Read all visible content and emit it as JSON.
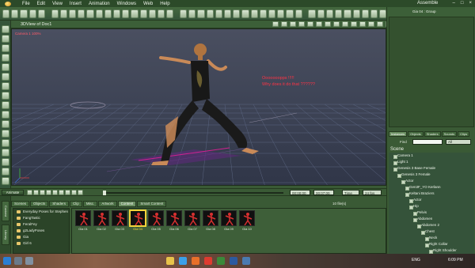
{
  "menubar": {
    "items": [
      "File",
      "Edit",
      "View",
      "Insert",
      "Animation",
      "Windows",
      "Web",
      "Help"
    ],
    "right_label": "Assemble"
  },
  "viewport": {
    "title": "3DView of Doc1",
    "camera_label": "Camera 1 100%",
    "annotation_lines": [
      "Ooooooopps !!!!!",
      "Why does it do that ??????"
    ],
    "annotation_color": "#ff3345"
  },
  "timeline": {
    "animate_label": "Animate",
    "start_time": "00:00:00",
    "end_time": "00:07:00",
    "mode": "Time",
    "fps": "24 fps"
  },
  "content": {
    "tabs": [
      "Scenes",
      "Objects",
      "Shaders",
      "Clip",
      "Misc.",
      "Artwork",
      "Content",
      "Smart Content"
    ],
    "active_tab": "Content",
    "files_count": "10 file(s)",
    "categories": [
      "Everyday Poses for Stephen",
      "FangTastic",
      "FeralFey",
      "g2LadyPoses",
      "Gia",
      "Girl 6"
    ],
    "thumbnails": [
      "Gia 01",
      "Gia 02",
      "Gia 03",
      "Gia 04",
      "Gia 05",
      "Gia 06",
      "Gia 07",
      "Gia 08",
      "Gia 09",
      "Gia 10"
    ],
    "selected_thumb": "Gia 04",
    "side_tabs": [
      "Content",
      "Library"
    ]
  },
  "right_panel": {
    "top_title": "Gia 04 : Group",
    "tabs": [
      "Instances",
      "Objects",
      "Shaders",
      "Sounds",
      "Clips"
    ],
    "active_tab": "Instances",
    "find_label": "Find",
    "find_value": "",
    "filter_value": "All",
    "scene_title": "Scene",
    "tree": [
      {
        "label": "Camera 1",
        "depth": 1
      },
      {
        "label": "Light 1",
        "depth": 1
      },
      {
        "label": "Genesis 3 Base Female",
        "depth": 1
      },
      {
        "label": "Genesis 3 Female",
        "depth": 2
      },
      {
        "label": "Actor",
        "depth": 3
      },
      {
        "label": "Gen3F_YO Kerlann",
        "depth": 4
      },
      {
        "label": "Keltani Braziers",
        "depth": 4
      },
      {
        "label": "Actor",
        "depth": 5
      },
      {
        "label": "Hip",
        "depth": 5
      },
      {
        "label": "Pelvis",
        "depth": 6
      },
      {
        "label": "Abdomen",
        "depth": 6
      },
      {
        "label": "Abdomen 2",
        "depth": 7
      },
      {
        "label": "Chest",
        "depth": 8
      },
      {
        "label": "Neck",
        "depth": 9
      },
      {
        "label": "Right Collar",
        "depth": 9
      },
      {
        "label": "Right Shoulder",
        "depth": 10
      },
      {
        "label": "Right ForeArm",
        "depth": 11
      },
      {
        "label": "Right Hand",
        "depth": 12
      }
    ]
  },
  "taskbar": {
    "tray_text": "ENG",
    "clock": "6:09 PM"
  },
  "colors": {
    "panel": "#3a5a35",
    "dark": "#24391f",
    "accent": "#f0d23a"
  }
}
